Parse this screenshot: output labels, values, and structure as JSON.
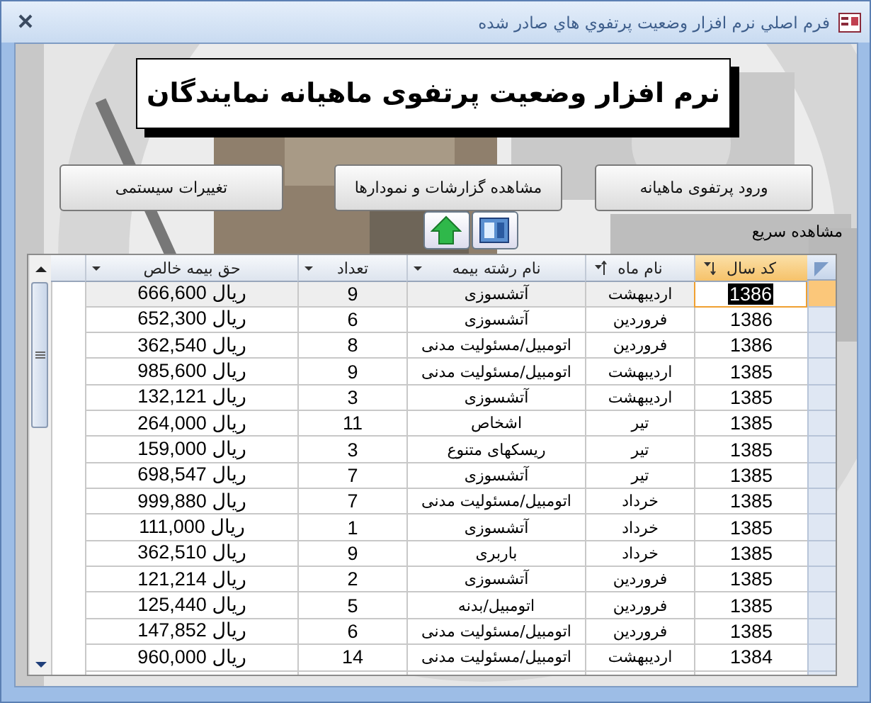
{
  "window": {
    "title": "فرم اصلي نرم افزار وضعيت پرتفوي هاي صادر شده"
  },
  "heading": "نرم افزار وضعیت پرتفوی ماهیانه نمایندگان",
  "buttons": [
    "ورود پرتفوی ماهیانه",
    "مشاهده گزارشات و نمودارها",
    "تغییرات سیستمی"
  ],
  "quick_view_label": "مشاهده سريع",
  "table": {
    "columns": [
      {
        "label": "کد سال",
        "sorted_descending": true,
        "sorted_ascending": false,
        "selected": true
      },
      {
        "label": "نام ماه",
        "sorted_descending": false,
        "sorted_ascending": true,
        "selected": false
      },
      {
        "label": "نام رشته بیمه",
        "sorted_descending": false,
        "sorted_ascending": false,
        "selected": false
      },
      {
        "label": "تعداد",
        "sorted_descending": false,
        "sorted_ascending": false,
        "selected": false
      },
      {
        "label": "حق بیمه خالص",
        "sorted_descending": false,
        "sorted_ascending": false,
        "selected": false
      }
    ],
    "rows": [
      {
        "selected": true,
        "cells": [
          "1386",
          "اردیبهشت",
          "آتشسوزی",
          "9",
          "ريال 666,600"
        ]
      },
      {
        "selected": false,
        "cells": [
          "1386",
          "فروردين",
          "آتشسوزی",
          "6",
          "ريال 652,300"
        ]
      },
      {
        "selected": false,
        "cells": [
          "1386",
          "فروردين",
          "اتومبيل/مسئوليت مدنی",
          "8",
          "ريال 362,540"
        ]
      },
      {
        "selected": false,
        "cells": [
          "1385",
          "ارديبهشت",
          "اتومبيل/مسئوليت مدنی",
          "9",
          "ريال 985,600"
        ]
      },
      {
        "selected": false,
        "cells": [
          "1385",
          "ارديبهشت",
          "آتشسوزی",
          "3",
          "ريال 132,121"
        ]
      },
      {
        "selected": false,
        "cells": [
          "1385",
          "تير",
          "اشخاص",
          "11",
          "ريال 264,000"
        ]
      },
      {
        "selected": false,
        "cells": [
          "1385",
          "تير",
          "ريسکهای متنوع",
          "3",
          "ريال 159,000"
        ]
      },
      {
        "selected": false,
        "cells": [
          "1385",
          "تير",
          "آتشسوزی",
          "7",
          "ريال 698,547"
        ]
      },
      {
        "selected": false,
        "cells": [
          "1385",
          "خرداد",
          "اتومبيل/مسئوليت مدنی",
          "7",
          "ريال 999,880"
        ]
      },
      {
        "selected": false,
        "cells": [
          "1385",
          "خرداد",
          "آتشسوزی",
          "1",
          "ريال 111,000"
        ]
      },
      {
        "selected": false,
        "cells": [
          "1385",
          "خرداد",
          "باربری",
          "9",
          "ريال 362,510"
        ]
      },
      {
        "selected": false,
        "cells": [
          "1385",
          "فروردين",
          "آتشسوزی",
          "2",
          "ريال 121,214"
        ]
      },
      {
        "selected": false,
        "cells": [
          "1385",
          "فروردين",
          "اتومبيل/بدنه",
          "5",
          "ريال 125,440"
        ]
      },
      {
        "selected": false,
        "cells": [
          "1385",
          "فروردين",
          "اتومبيل/مسئوليت مدنی",
          "6",
          "ريال 147,852"
        ]
      },
      {
        "selected": false,
        "cells": [
          "1384",
          "ارديبهشت",
          "اتومبيل/مسئوليت مدنی",
          "14",
          "ريال 960,000"
        ]
      }
    ]
  }
}
